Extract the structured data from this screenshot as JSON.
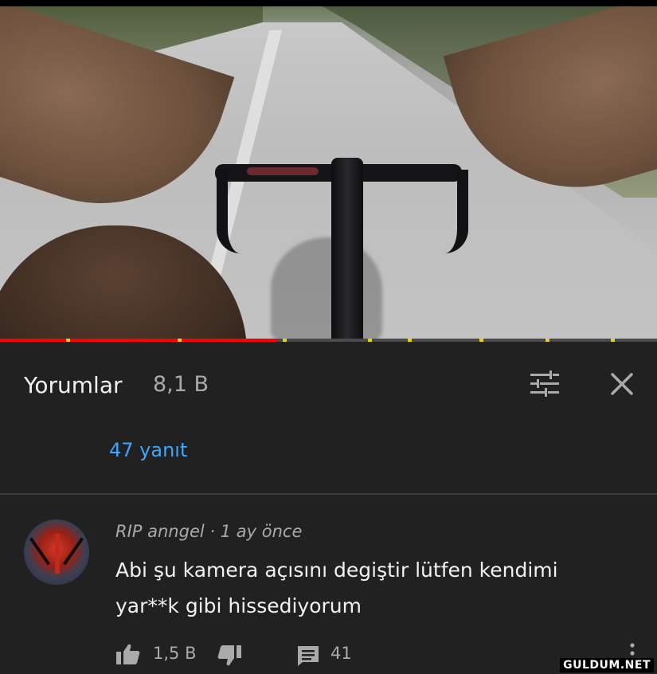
{
  "video": {
    "progress_percent": 42,
    "chapter_marks_percent": [
      10,
      27,
      43,
      56,
      62,
      73,
      83,
      93
    ]
  },
  "comments_panel": {
    "title": "Yorumlar",
    "count": "8,1 B",
    "sort_icon": "sort-filter-icon",
    "close_icon": "close-icon"
  },
  "replies": {
    "label": "47 yanıt"
  },
  "comment": {
    "author": "RIP anngel",
    "separator": "·",
    "time": "1 ay önce",
    "text": "Abi şu kamera açısını degiştir lütfen kendimi yar**k gibi hissediyorum",
    "likes": "1,5 B",
    "replies": "41"
  },
  "watermark": "GULDUM.NET",
  "colors": {
    "background": "#212121",
    "link": "#3ea6ff",
    "progress": "#ff0000",
    "secondary_text": "#aaaaaa"
  }
}
